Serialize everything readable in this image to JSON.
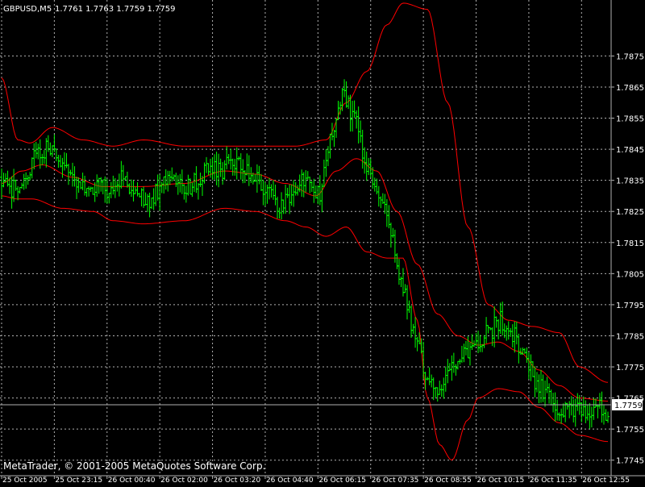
{
  "header": {
    "symbol": "GBPUSD,M5",
    "quote": "1.7761 1.7763 1.7759 1.7759"
  },
  "watermark": "MetaTrader, © 2001-2005 MetaQuotes Software Corp.",
  "colors": {
    "background": "#000000",
    "grid": "#b0b0b0",
    "text": "#ffffff",
    "candle": "#00ff00",
    "bands": "#ff0000",
    "price_line": "#b0b0b0",
    "price_label_bg": "#ffffff",
    "price_label_text": "#000000"
  },
  "chart_data": {
    "type": "line",
    "title": "GBPUSD,M5",
    "candle_style": "bar",
    "grid": true,
    "ylim": [
      1.774,
      1.7893
    ],
    "y_ticks": [
      "1.7875",
      "1.7865",
      "1.7855",
      "1.7845",
      "1.7835",
      "1.7825",
      "1.7815",
      "1.7805",
      "1.7795",
      "1.7785",
      "1.7775",
      "1.7765",
      "1.7755",
      "1.7745"
    ],
    "x_ticks": [
      "25 Oct 2005",
      "25 Oct 23:15",
      "26 Oct 00:40",
      "26 Oct 02:00",
      "26 Oct 03:20",
      "26 Oct 04:40",
      "26 Oct 06:15",
      "26 Oct 07:35",
      "26 Oct 08:55",
      "26 Oct 10:15",
      "26 Oct 11:35",
      "26 Oct 12:55"
    ],
    "current_price": "1.7759",
    "price_anchors": [
      [
        0,
        1.7836
      ],
      [
        6,
        1.7832
      ],
      [
        12,
        1.7838
      ],
      [
        18,
        1.7844
      ],
      [
        24,
        1.7845
      ],
      [
        30,
        1.784
      ],
      [
        36,
        1.7834
      ],
      [
        42,
        1.7832
      ],
      [
        48,
        1.7834
      ],
      [
        54,
        1.7832
      ],
      [
        60,
        1.7836
      ],
      [
        66,
        1.783
      ],
      [
        72,
        1.7828
      ],
      [
        78,
        1.7832
      ],
      [
        84,
        1.7838
      ],
      [
        90,
        1.7832
      ],
      [
        96,
        1.7835
      ],
      [
        102,
        1.784
      ],
      [
        108,
        1.7838
      ],
      [
        114,
        1.7842
      ],
      [
        120,
        1.7838
      ],
      [
        126,
        1.7835
      ],
      [
        132,
        1.783
      ],
      [
        138,
        1.7827
      ],
      [
        144,
        1.7832
      ],
      [
        150,
        1.7835
      ],
      [
        156,
        1.783
      ],
      [
        162,
        1.7848
      ],
      [
        168,
        1.7862
      ],
      [
        174,
        1.7855
      ],
      [
        180,
        1.784
      ],
      [
        186,
        1.7832
      ],
      [
        192,
        1.7818
      ],
      [
        198,
        1.78
      ],
      [
        204,
        1.7785
      ],
      [
        210,
        1.7772
      ],
      [
        216,
        1.7768
      ],
      [
        222,
        1.7774
      ],
      [
        228,
        1.778
      ],
      [
        234,
        1.7782
      ],
      [
        240,
        1.7786
      ],
      [
        246,
        1.779
      ],
      [
        252,
        1.7786
      ],
      [
        258,
        1.7778
      ],
      [
        264,
        1.777
      ],
      [
        270,
        1.7765
      ],
      [
        276,
        1.776
      ],
      [
        282,
        1.7762
      ],
      [
        288,
        1.776
      ],
      [
        294,
        1.7762
      ],
      [
        299,
        1.7759
      ]
    ],
    "upper_band_anchors": [
      [
        0,
        1.7868
      ],
      [
        8,
        1.7848
      ],
      [
        14,
        1.7847
      ],
      [
        25,
        1.7852
      ],
      [
        40,
        1.7848
      ],
      [
        55,
        1.7846
      ],
      [
        70,
        1.7848
      ],
      [
        90,
        1.7846
      ],
      [
        110,
        1.7846
      ],
      [
        125,
        1.7846
      ],
      [
        145,
        1.7846
      ],
      [
        160,
        1.7848
      ],
      [
        170,
        1.786
      ],
      [
        180,
        1.787
      ],
      [
        190,
        1.7885
      ],
      [
        198,
        1.7892
      ],
      [
        210,
        1.789
      ],
      [
        220,
        1.786
      ],
      [
        230,
        1.782
      ],
      [
        240,
        1.7795
      ],
      [
        250,
        1.779
      ],
      [
        262,
        1.7788
      ],
      [
        275,
        1.7786
      ],
      [
        285,
        1.7775
      ],
      [
        299,
        1.777
      ]
    ],
    "middle_band_anchors": [
      [
        0,
        1.7834
      ],
      [
        10,
        1.7838
      ],
      [
        20,
        1.784
      ],
      [
        35,
        1.7836
      ],
      [
        50,
        1.7833
      ],
      [
        70,
        1.7833
      ],
      [
        90,
        1.7834
      ],
      [
        110,
        1.7838
      ],
      [
        125,
        1.7837
      ],
      [
        140,
        1.7834
      ],
      [
        155,
        1.783
      ],
      [
        165,
        1.7838
      ],
      [
        175,
        1.7842
      ],
      [
        185,
        1.7838
      ],
      [
        195,
        1.7825
      ],
      [
        205,
        1.7808
      ],
      [
        215,
        1.7792
      ],
      [
        225,
        1.7785
      ],
      [
        235,
        1.7782
      ],
      [
        245,
        1.7783
      ],
      [
        255,
        1.778
      ],
      [
        265,
        1.7774
      ],
      [
        275,
        1.7769
      ],
      [
        285,
        1.7765
      ],
      [
        299,
        1.7764
      ]
    ],
    "lower_band_anchors": [
      [
        0,
        1.783
      ],
      [
        8,
        1.7829
      ],
      [
        15,
        1.7829
      ],
      [
        30,
        1.7826
      ],
      [
        45,
        1.7825
      ],
      [
        55,
        1.7822
      ],
      [
        70,
        1.7821
      ],
      [
        90,
        1.7822
      ],
      [
        110,
        1.7826
      ],
      [
        125,
        1.7825
      ],
      [
        140,
        1.7822
      ],
      [
        150,
        1.782
      ],
      [
        160,
        1.7817
      ],
      [
        170,
        1.782
      ],
      [
        180,
        1.7812
      ],
      [
        190,
        1.781
      ],
      [
        198,
        1.781
      ],
      [
        205,
        1.779
      ],
      [
        210,
        1.7765
      ],
      [
        216,
        1.775
      ],
      [
        222,
        1.7745
      ],
      [
        230,
        1.7758
      ],
      [
        235,
        1.7765
      ],
      [
        245,
        1.7768
      ],
      [
        255,
        1.7767
      ],
      [
        265,
        1.7762
      ],
      [
        275,
        1.7757
      ],
      [
        285,
        1.7753
      ],
      [
        299,
        1.7751
      ]
    ]
  }
}
